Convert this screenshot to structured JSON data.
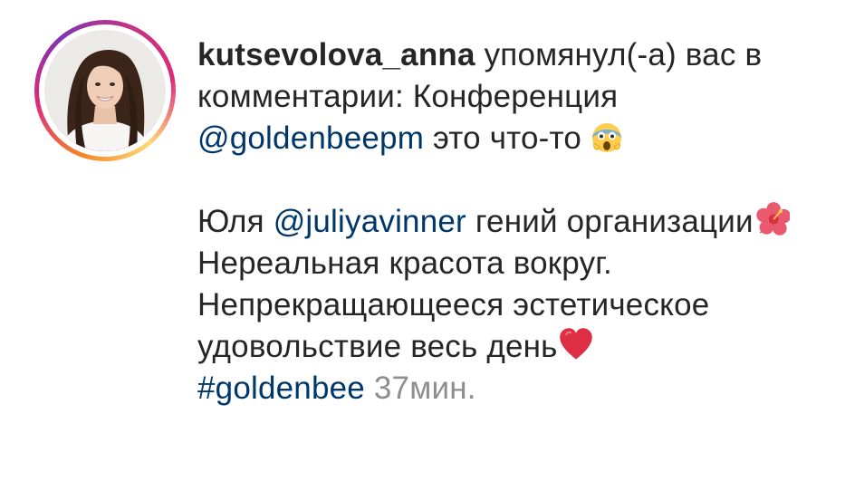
{
  "notification": {
    "username": "kutsevolova_anna",
    "action_text": " упомянул(-а) вас в комментарии: Конференция ",
    "mention_1": "@goldenbeepm",
    "text_after_mention_1": " это что-то ",
    "emoji_1": "face-screaming-in-fear-icon",
    "comment_part_1": "Юля ",
    "mention_2": "@juliyavinner",
    "comment_part_2": " гений организации",
    "emoji_2": "hibiscus-icon",
    "line_2": "Нереальная красота вокруг.",
    "line_3": "Непрекращающееся эстетическое удовольствие весь день",
    "emoji_3": "red-heart-icon",
    "hashtag": "#goldenbee",
    "timestamp": " 37мин."
  },
  "colors": {
    "text": "#262626",
    "link": "#00376b",
    "muted": "#8e8e8e",
    "ring_gradient": [
      "#f58529",
      "#dd2a7b",
      "#8134af",
      "#feda77"
    ]
  }
}
